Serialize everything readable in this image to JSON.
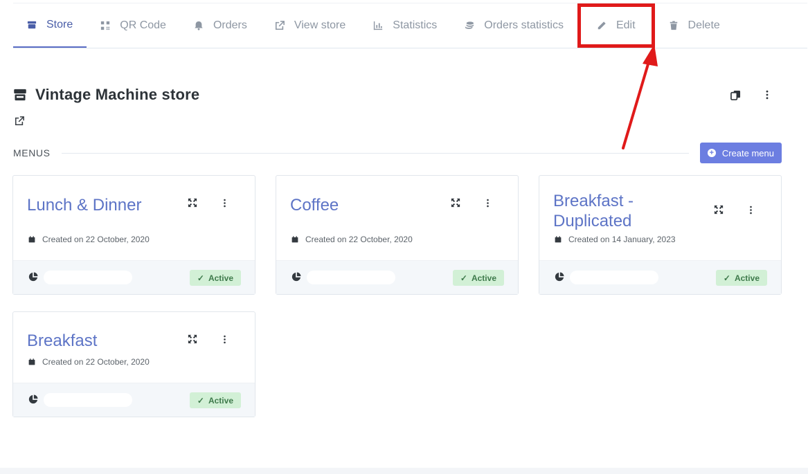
{
  "tabs": [
    {
      "label": "Store",
      "icon": "store-icon"
    },
    {
      "label": "QR Code",
      "icon": "qrcode-icon"
    },
    {
      "label": "Orders",
      "icon": "bell-icon"
    },
    {
      "label": "View store",
      "icon": "external-link-icon"
    },
    {
      "label": "Statistics",
      "icon": "bar-chart-icon"
    },
    {
      "label": "Orders statistics",
      "icon": "coins-icon"
    },
    {
      "label": "Edit",
      "icon": "pencil-icon"
    },
    {
      "label": "Delete",
      "icon": "trash-icon"
    }
  ],
  "store": {
    "title": "Vintage Machine store"
  },
  "menus": {
    "label": "MENUS",
    "create_label": "Create menu"
  },
  "cards": [
    {
      "title": "Lunch & Dinner",
      "date": "Created on 22 October, 2020",
      "status": "Active"
    },
    {
      "title": "Coffee",
      "date": "Created on 22 October, 2020",
      "status": "Active"
    },
    {
      "title": "Breakfast - Duplicated",
      "date": "Created on 14 January, 2023",
      "status": "Active"
    },
    {
      "title": "Breakfast",
      "date": "Created on 22 October, 2020",
      "status": "Active"
    }
  ],
  "colors": {
    "accent": "#5d74c6",
    "button": "#6c7ee1",
    "annotation": "#e01a1a",
    "active_badge": "#d2f0d6"
  }
}
